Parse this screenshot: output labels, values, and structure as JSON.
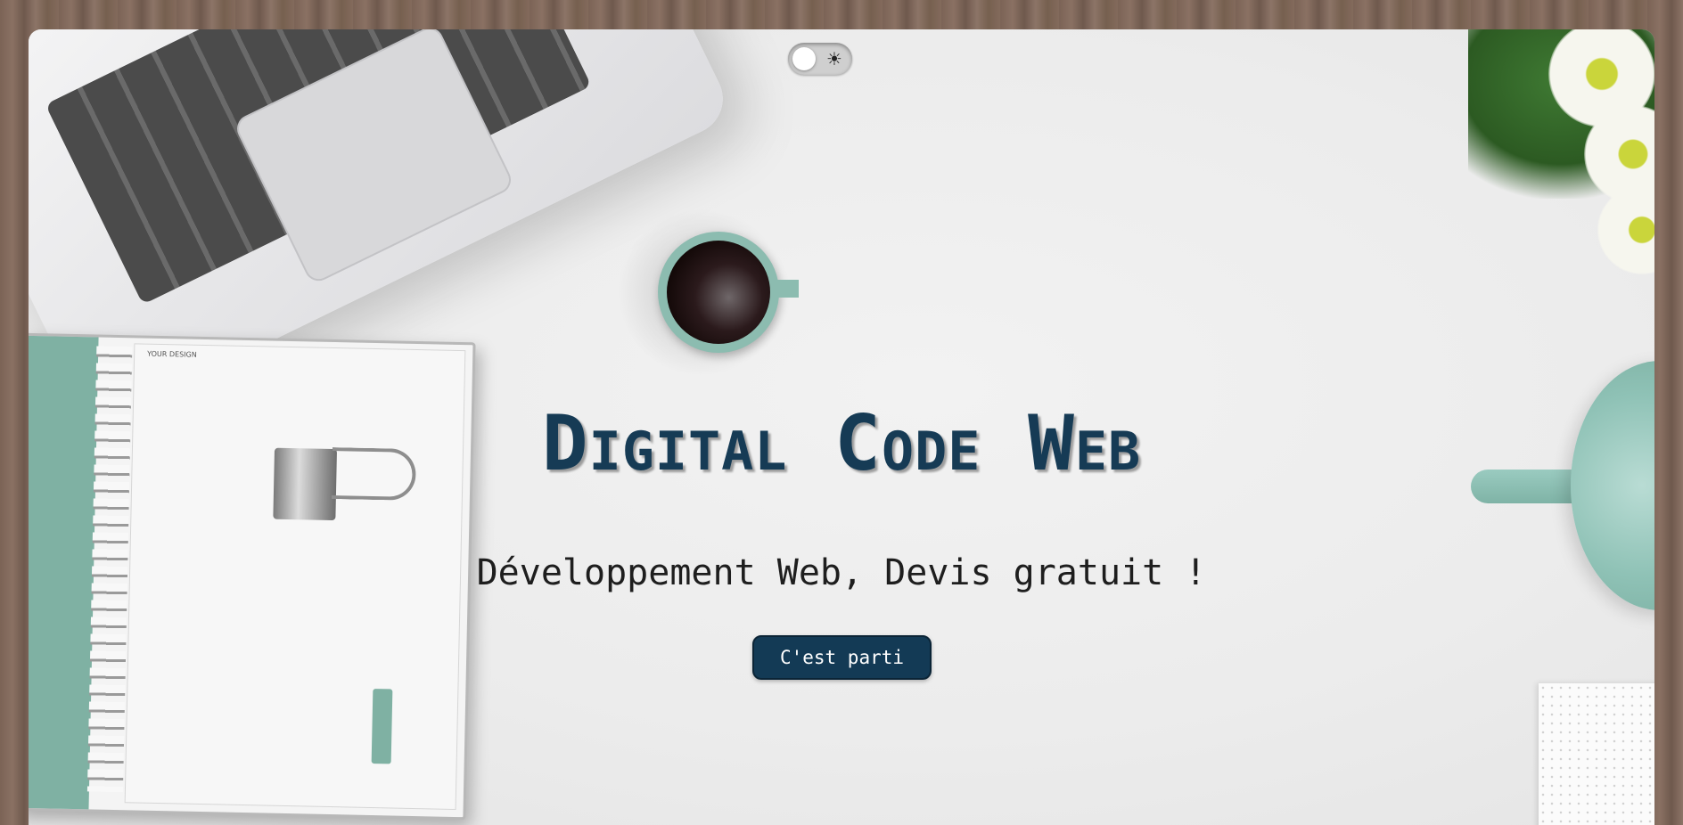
{
  "theme_toggle": {
    "icon": "sun-icon",
    "sun_glyph": "☀",
    "state": "light"
  },
  "hero": {
    "title": "Digital Code Web",
    "subtitle": "Développement Web, Devis gratuit !",
    "cta_label": "C'est parti"
  },
  "decor": {
    "notebook_brand": "YOUR DESIGN"
  },
  "colors": {
    "title": "#163b55",
    "cta_background": "#133a55",
    "accent_teal": "#8cbcb0"
  }
}
